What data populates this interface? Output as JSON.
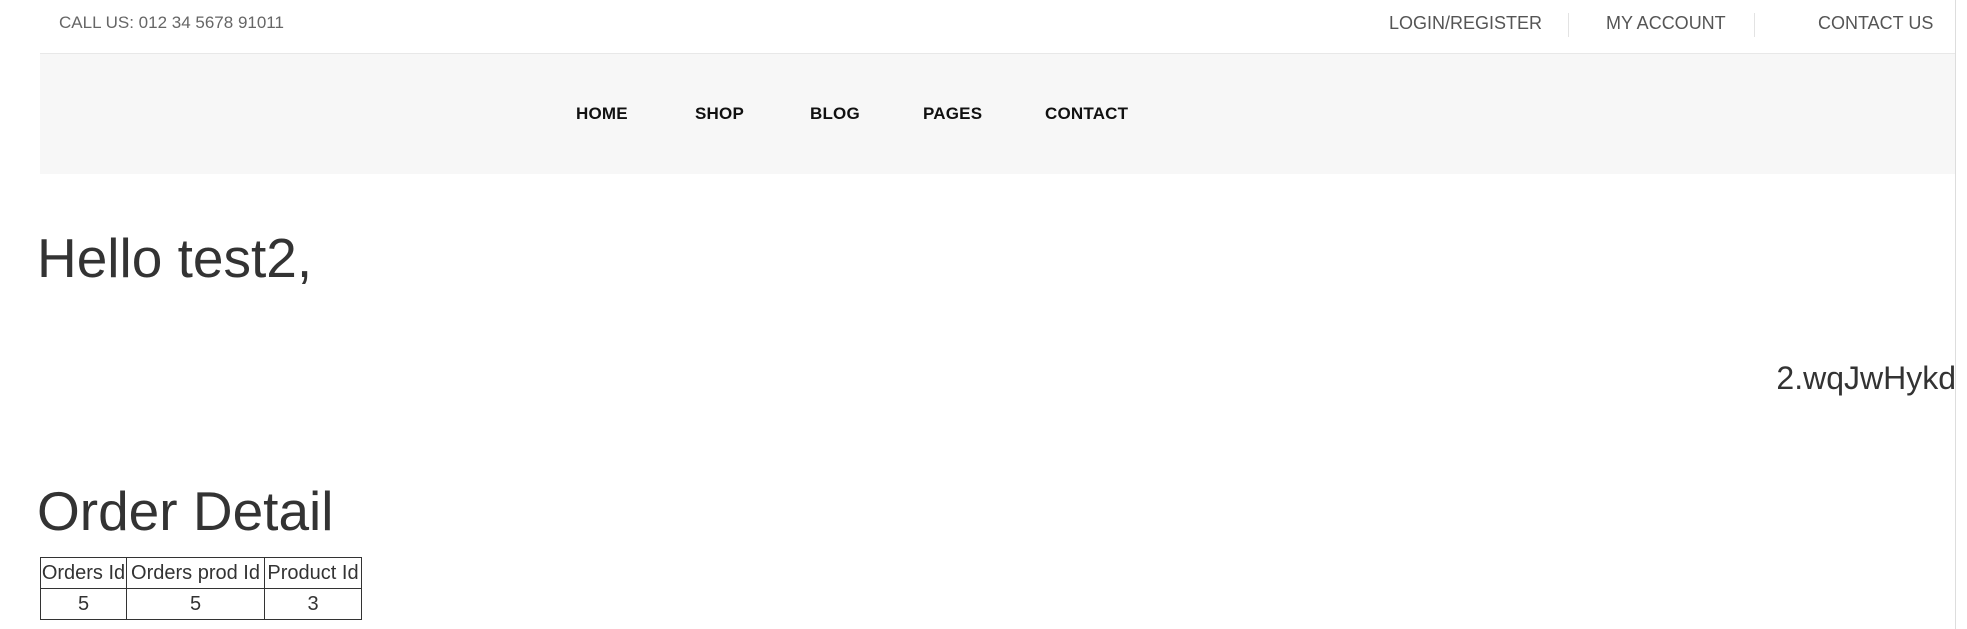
{
  "topbar": {
    "call_us": "CALL US: 012 34 5678 91011",
    "links": [
      {
        "label": "LOGIN/REGISTER"
      },
      {
        "label": "MY ACCOUNT"
      },
      {
        "label": "CONTACT US"
      }
    ]
  },
  "nav": {
    "items": [
      {
        "label": "HOME"
      },
      {
        "label": "SHOP"
      },
      {
        "label": "BLOG"
      },
      {
        "label": "PAGES"
      },
      {
        "label": "CONTACT"
      }
    ]
  },
  "main": {
    "greeting": "Hello test2,",
    "token_fragment": "2.wqJwHykd",
    "order_section_title": "Order Detail",
    "order_table": {
      "headers": [
        "Orders Id",
        "Orders prod Id",
        "Product Id"
      ],
      "rows": [
        [
          "5",
          "5",
          "3"
        ]
      ]
    }
  }
}
